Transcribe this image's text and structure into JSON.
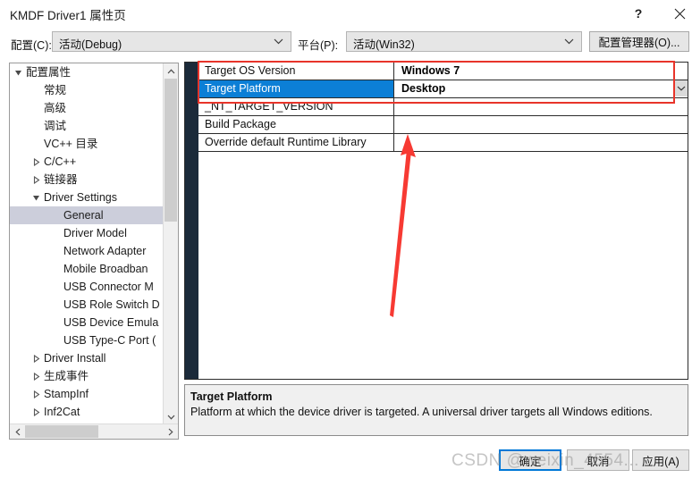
{
  "window": {
    "title": "KMDF Driver1 属性页",
    "help_icon": "question-mark-icon",
    "close_icon": "close-icon"
  },
  "config_bar": {
    "config_label": "配置(C):",
    "config_value": "活动(Debug)",
    "platform_label": "平台(P):",
    "platform_value": "活动(Win32)",
    "config_manager_button": "配置管理器(O)..."
  },
  "tree": {
    "items": [
      {
        "label": "配置属性",
        "indent": 18,
        "arrow": "expanded",
        "selected": false
      },
      {
        "label": "常规",
        "indent": 38,
        "arrow": "none",
        "selected": false
      },
      {
        "label": "高级",
        "indent": 38,
        "arrow": "none",
        "selected": false
      },
      {
        "label": "调试",
        "indent": 38,
        "arrow": "none",
        "selected": false
      },
      {
        "label": "VC++ 目录",
        "indent": 38,
        "arrow": "none",
        "selected": false
      },
      {
        "label": "C/C++",
        "indent": 38,
        "arrow": "collapsed",
        "selected": false
      },
      {
        "label": "链接器",
        "indent": 38,
        "arrow": "collapsed",
        "selected": false
      },
      {
        "label": "Driver Settings",
        "indent": 38,
        "arrow": "expanded",
        "selected": false
      },
      {
        "label": "General",
        "indent": 60,
        "arrow": "none",
        "selected": true
      },
      {
        "label": "Driver Model",
        "indent": 60,
        "arrow": "none",
        "selected": false
      },
      {
        "label": "Network Adapter",
        "indent": 60,
        "arrow": "none",
        "selected": false
      },
      {
        "label": "Mobile Broadban",
        "indent": 60,
        "arrow": "none",
        "selected": false
      },
      {
        "label": "USB Connector M",
        "indent": 60,
        "arrow": "none",
        "selected": false
      },
      {
        "label": "USB Role Switch D",
        "indent": 60,
        "arrow": "none",
        "selected": false
      },
      {
        "label": "USB Device Emula",
        "indent": 60,
        "arrow": "none",
        "selected": false
      },
      {
        "label": "USB Type-C Port (",
        "indent": 60,
        "arrow": "none",
        "selected": false
      },
      {
        "label": "Driver Install",
        "indent": 38,
        "arrow": "collapsed",
        "selected": false
      },
      {
        "label": "生成事件",
        "indent": 38,
        "arrow": "collapsed",
        "selected": false
      },
      {
        "label": "StampInf",
        "indent": 38,
        "arrow": "collapsed",
        "selected": false
      },
      {
        "label": "Inf2Cat",
        "indent": 38,
        "arrow": "collapsed",
        "selected": false
      }
    ]
  },
  "grid": {
    "rows": [
      {
        "name": "Target OS Version",
        "value": "Windows 7",
        "selected": false,
        "has_dropdown": false
      },
      {
        "name": "Target Platform",
        "value": "Desktop",
        "selected": true,
        "has_dropdown": true
      },
      {
        "name": "_NT_TARGET_VERSION",
        "value": "",
        "selected": false,
        "has_dropdown": false
      },
      {
        "name": "Build Package",
        "value": "",
        "selected": false,
        "has_dropdown": false
      },
      {
        "name": "Override default Runtime Library",
        "value": "",
        "selected": false,
        "has_dropdown": false
      }
    ]
  },
  "description": {
    "title": "Target Platform",
    "body": "Platform at which the device driver is targeted. A universal driver targets all Windows editions."
  },
  "buttons": {
    "ok": "确定",
    "cancel": "取消",
    "apply": "应用(A)"
  },
  "watermark": {
    "text": "CSDN @weixin_4554..."
  },
  "colors": {
    "selection_blue": "#0c7fd6",
    "tree_selection": "#cccedb",
    "annotation_red": "#e8342a",
    "focus_blue": "#0078d7",
    "grid_gutter": "#1b2a3a"
  }
}
